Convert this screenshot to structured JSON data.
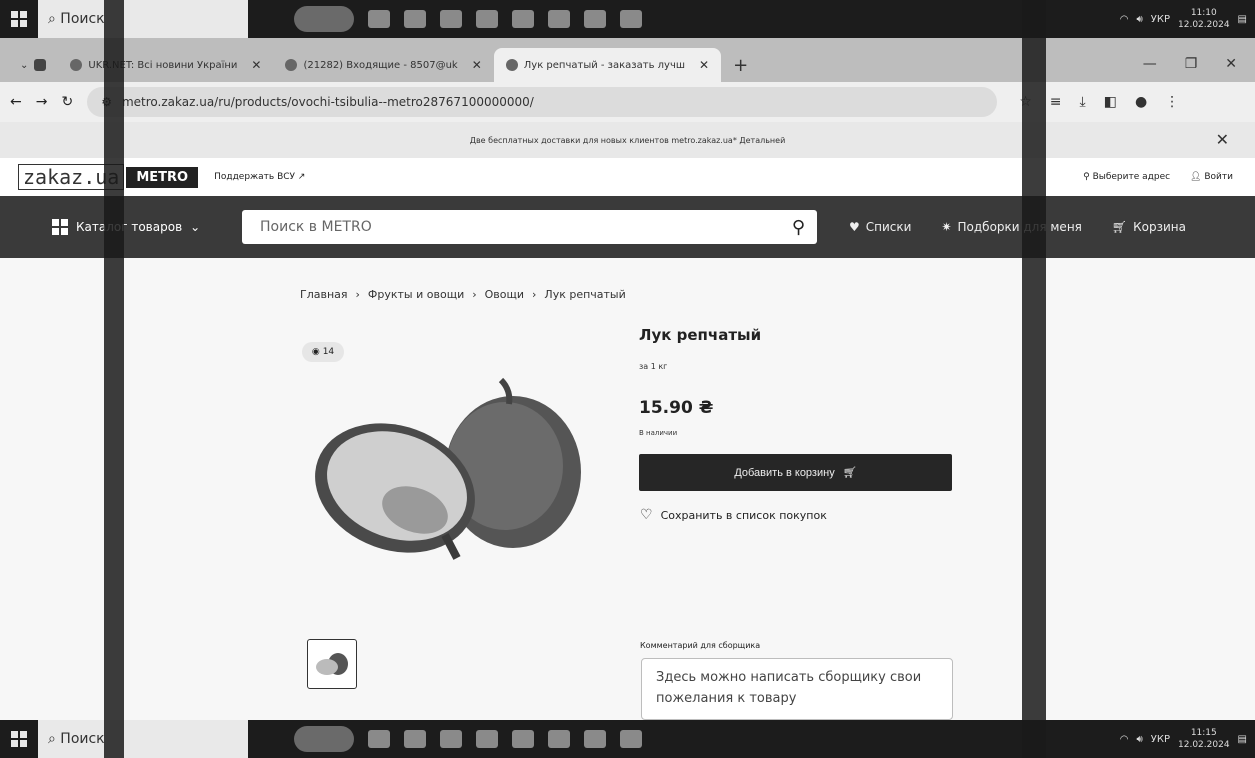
{
  "taskbar": {
    "search_label": "Поиск",
    "lang": "УКР",
    "time_top": "11:10",
    "date_top": "12.02.2024",
    "time_bottom": "11:15",
    "date_bottom": "12.02.2024"
  },
  "browser": {
    "tabs": [
      {
        "label": "UKR.NET: Всі новини України"
      },
      {
        "label": "(21282) Входящие - 8507@uk"
      },
      {
        "label": "Лук репчатый - заказать лучш"
      }
    ],
    "url": "metro.zakaz.ua/ru/products/ovochi-tsibulia--metro28767100000000/"
  },
  "promo": {
    "text": "Две бесплатных доставки для новых клиентов metro.zakaz.ua* Детальней"
  },
  "site": {
    "logo_zakaz": "zakaz.ua",
    "logo_metro": "METRO",
    "support": "Поддержать ВСУ ↗",
    "address": "Выберите адрес",
    "login": "Войти"
  },
  "nav": {
    "catalog": "Каталог товаров",
    "search_placeholder": "Поиск в METRO",
    "lists": "Списки",
    "selections": "Подборки для меня",
    "cart": "Корзина"
  },
  "breadcrumbs": [
    "Главная",
    "Фрукты и овощи",
    "Овощи",
    "Лук репчатый"
  ],
  "product": {
    "views": "14",
    "title": "Лук репчатый",
    "unit": "за 1 кг",
    "price": "15.90 ₴",
    "stock": "В наличии",
    "add_to_cart": "Добавить в корзину",
    "save_list": "Сохранить в список покупок",
    "comment_label": "Комментарий для сборщика",
    "comment_placeholder": "Здесь можно написать сборщику свои пожелания к товару"
  }
}
